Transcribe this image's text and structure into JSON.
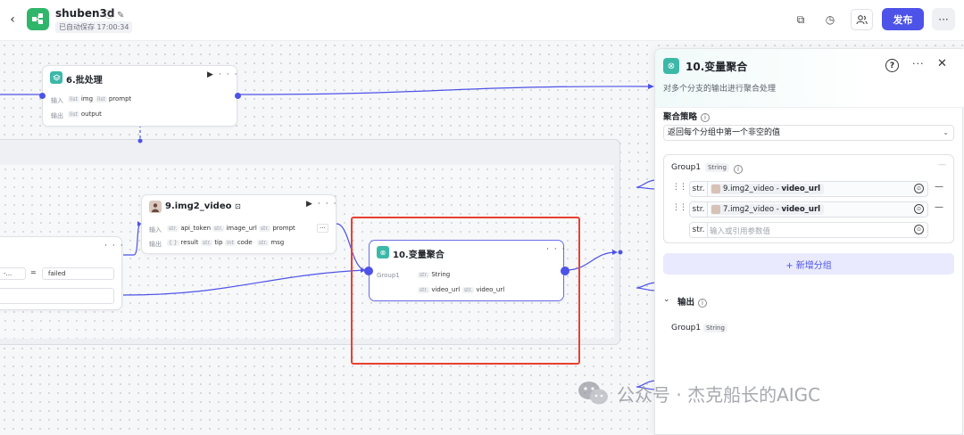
{
  "header": {
    "back_icon": "chevron-left-icon",
    "app_name": "shuben3d",
    "autosave": "已自动保存 17:00:34",
    "publish_label": "发布",
    "more_label": "···"
  },
  "nodes": {
    "batch": {
      "title": "6.批处理",
      "input_label": "输入",
      "output_label": "输出",
      "inputs": [
        {
          "type": "list",
          "name": "img"
        },
        {
          "type": "list",
          "name": "prompt"
        }
      ],
      "outputs": [
        {
          "type": "list",
          "name": "output"
        }
      ]
    },
    "img2video": {
      "title": "9.img2_video",
      "input_label": "输入",
      "output_label": "输出",
      "inputs": [
        {
          "type": "str.",
          "name": "api_token"
        },
        {
          "type": "str.",
          "name": "image_url"
        },
        {
          "type": "str.",
          "name": "prompt"
        }
      ],
      "outputs": [
        {
          "type": "{ }",
          "name": "result"
        },
        {
          "type": "str.",
          "name": "tip"
        },
        {
          "type": "int",
          "name": "code"
        },
        {
          "type": "str.",
          "name": "msg"
        }
      ]
    },
    "condition": {
      "left_value": "-...",
      "operator": "=",
      "right_value": "failed"
    },
    "aggregate": {
      "title": "10.变量聚合",
      "group_label": "Group1",
      "group_type": "String",
      "values": [
        {
          "type": "str.",
          "name": "video_url"
        },
        {
          "type": "str.",
          "name": "video_url"
        }
      ]
    }
  },
  "panel": {
    "title": "10.变量聚合",
    "description": "对多个分支的输出进行聚合处理",
    "strategy_label": "聚合策略",
    "strategy_value": "返回每个分组中第一个非空的值",
    "group": {
      "name": "Group1",
      "type": "String",
      "rows": [
        {
          "type": "str.",
          "source": "9.img2_video",
          "field": "video_url"
        },
        {
          "type": "str.",
          "source": "7.img2_video",
          "field": "video_url"
        }
      ],
      "placeholder": "输入或引用参数值"
    },
    "add_group_label": "+ 新增分组",
    "output_label": "输出",
    "output_group": "Group1",
    "output_type": "String"
  },
  "watermark": "公众号 · 杰克船长的AIGC",
  "colors": {
    "accent": "#4d53e8",
    "highlight": "#e8402f",
    "node_icon": "#3cb8a8"
  }
}
